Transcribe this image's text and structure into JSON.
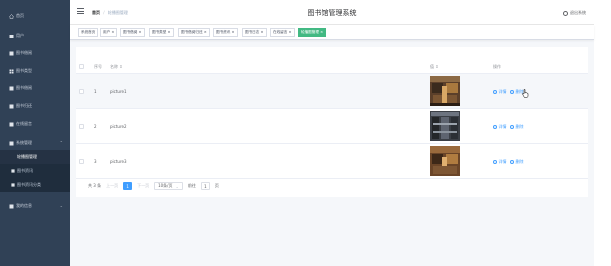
{
  "header": {
    "breadcrumb_home": "首页",
    "breadcrumb_separator": "/",
    "breadcrumb_current": "轮播图管理",
    "system_title": "图书馆管理系统",
    "logout_label": "退出系统"
  },
  "sidebar": {
    "items": [
      {
        "icon": "home-icon",
        "label": "首页"
      },
      {
        "icon": "user-icon",
        "label": "用户"
      },
      {
        "icon": "book-info-icon",
        "label": "图书借阅"
      },
      {
        "icon": "grid-icon",
        "label": "图书类型"
      },
      {
        "icon": "book-icon",
        "label": "图书借阅"
      },
      {
        "icon": "book-return-icon",
        "label": "图书归还"
      },
      {
        "icon": "message-icon",
        "label": "在线留言"
      },
      {
        "icon": "settings-icon",
        "label": "系统管理"
      }
    ],
    "submenu": [
      {
        "label": "轮播图管理"
      },
      {
        "label": "图书资讯"
      },
      {
        "label": "图书资讯分类"
      }
    ],
    "last_item": {
      "icon": "person-icon",
      "label": "我的信息"
    }
  },
  "tags": [
    {
      "label": "系统首页"
    },
    {
      "label": "用户 ×"
    },
    {
      "label": "图书借阅 ×"
    },
    {
      "label": "图书类型 ×"
    },
    {
      "label": "图书借阅归还 ×"
    },
    {
      "label": "图书资讯 ×"
    },
    {
      "label": "图书日志 ×"
    },
    {
      "label": "在线留言 ×"
    },
    {
      "label": "轮播图管理 ×"
    }
  ],
  "table": {
    "headers": {
      "index": "序号",
      "name": "名称 ⇕",
      "value": "值 ⇕",
      "actions": "操作"
    },
    "rows": [
      {
        "index": "1",
        "name": "picture1",
        "detail": "详情",
        "delete": "删除"
      },
      {
        "index": "2",
        "name": "picture2",
        "detail": "详情",
        "delete": "删除"
      },
      {
        "index": "3",
        "name": "picture3",
        "detail": "详情",
        "delete": "删除"
      }
    ]
  },
  "pagination": {
    "total": "共 3 条",
    "prev": "上一页",
    "current_page": "1",
    "next": "下一页",
    "page_size": "10条/页",
    "goto_label": "前往",
    "goto_value": "1",
    "page_unit": "页"
  },
  "colors": {
    "sidebar_bg": "#304156",
    "active_tag": "#42b983",
    "link": "#409eff",
    "page_bg": "#f5f7fa"
  }
}
